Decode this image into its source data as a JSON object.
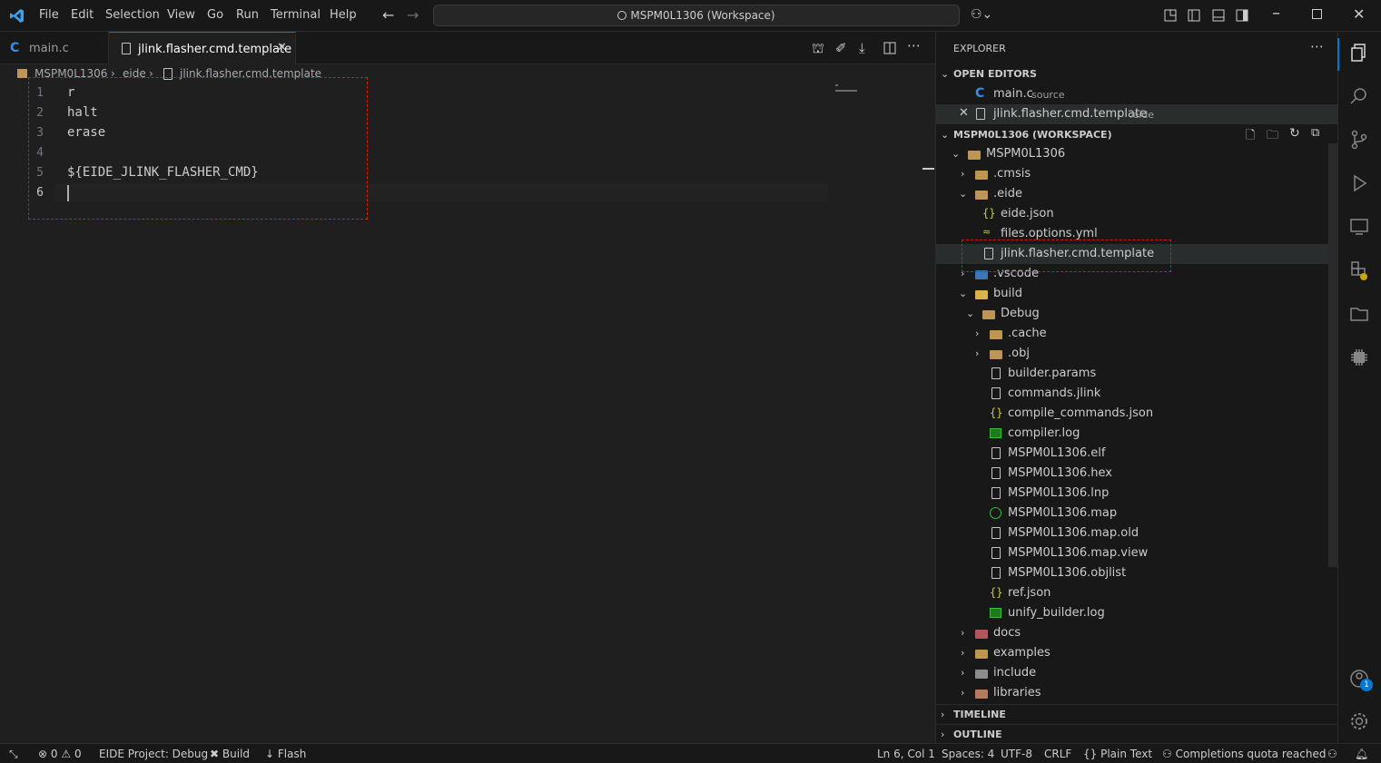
{
  "titlebar": {
    "menu": [
      "File",
      "Edit",
      "Selection",
      "View",
      "Go",
      "Run",
      "Terminal",
      "Help"
    ],
    "command_center": "MSPM0L1306 (Workspace)"
  },
  "tabs": [
    {
      "label": "main.c",
      "icon": "c-icon",
      "active": false
    },
    {
      "label": "jlink.flasher.cmd.template",
      "icon": "file-icon",
      "active": true
    }
  ],
  "breadcrumb": [
    "MSPM0L1306",
    "eide",
    "jlink.flasher.cmd.template"
  ],
  "editor": {
    "lines": [
      {
        "num": "1",
        "text": "r"
      },
      {
        "num": "2",
        "text": "halt"
      },
      {
        "num": "3",
        "text": "erase"
      },
      {
        "num": "4",
        "text": ""
      },
      {
        "num": "5",
        "text": "${EIDE_JLINK_FLASHER_CMD}"
      },
      {
        "num": "6",
        "text": ""
      }
    ]
  },
  "explorer": {
    "title": "EXPLORER",
    "open_editors_title": "OPEN EDITORS",
    "open_editors": [
      {
        "name": "main.c",
        "desc": "source"
      },
      {
        "name": "jlink.flasher.cmd.template",
        "desc": ".eide"
      }
    ],
    "workspace_title": "MSPM0L1306 (WORKSPACE)",
    "tree": [
      {
        "name": "MSPM0L1306"
      },
      {
        "name": ".cmsis"
      },
      {
        "name": ".eide"
      },
      {
        "name": "eide.json"
      },
      {
        "name": "files.options.yml"
      },
      {
        "name": "jlink.flasher.cmd.template"
      },
      {
        "name": ".vscode"
      },
      {
        "name": "build"
      },
      {
        "name": "Debug"
      },
      {
        "name": ".cache"
      },
      {
        "name": ".obj"
      },
      {
        "name": "builder.params"
      },
      {
        "name": "commands.jlink"
      },
      {
        "name": "compile_commands.json"
      },
      {
        "name": "compiler.log"
      },
      {
        "name": "MSPM0L1306.elf"
      },
      {
        "name": "MSPM0L1306.hex"
      },
      {
        "name": "MSPM0L1306.lnp"
      },
      {
        "name": "MSPM0L1306.map"
      },
      {
        "name": "MSPM0L1306.map.old"
      },
      {
        "name": "MSPM0L1306.map.view"
      },
      {
        "name": "MSPM0L1306.objlist"
      },
      {
        "name": "ref.json"
      },
      {
        "name": "unify_builder.log"
      },
      {
        "name": "docs"
      },
      {
        "name": "examples"
      },
      {
        "name": "include"
      },
      {
        "name": "libraries"
      }
    ],
    "timeline_title": "TIMELINE",
    "outline_title": "OUTLINE"
  },
  "statusbar": {
    "errors": "0",
    "warnings": "0",
    "eide_project": "EIDE Project: Debug",
    "build": "Build",
    "flash": "Flash",
    "cursor": "Ln 6, Col 1",
    "spaces": "Spaces: 4",
    "encoding": "UTF-8",
    "eol": "CRLF",
    "language": "Plain Text",
    "copilot": "Completions quota reached"
  },
  "activity_badges": {
    "accounts": "1"
  },
  "colors": {
    "accent": "#0078d4",
    "highlight": "#e51400",
    "background": "#1f1f1f",
    "panel": "#181818"
  }
}
